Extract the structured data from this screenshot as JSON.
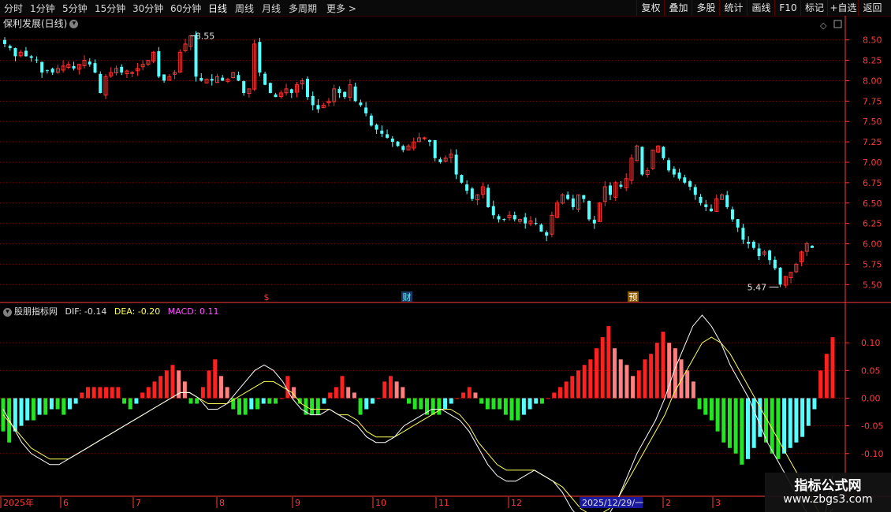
{
  "toolbar": {
    "timeframes": [
      "分时",
      "1分钟",
      "5分钟",
      "15分钟",
      "30分钟",
      "60分钟",
      "日线",
      "周线",
      "月线",
      "多周期",
      "更多 >"
    ],
    "active": "日线",
    "buttons": [
      "复权",
      "叠加",
      "多股",
      "统计",
      "画线",
      "F10",
      "标记",
      "+自选",
      "返回"
    ]
  },
  "price_panel": {
    "title": "保利发展(日线)",
    "high_label": "8.55",
    "low_label": "5.47",
    "markers": [
      "$",
      "财",
      "预"
    ]
  },
  "indicator_panel": {
    "title": "股朋指标网",
    "dif_label": "DIF: -0.14",
    "dea_label": "DEA: -0.20",
    "macd_label": "MACD: 0.11"
  },
  "date_axis": {
    "labels": [
      "2025年",
      "6",
      "7",
      "8",
      "9",
      "10",
      "11",
      "12",
      "2025/12/29/一",
      "2",
      "3"
    ]
  },
  "watermark": {
    "line1": "指标公式网",
    "line2": "www.zbgs3.com"
  },
  "colors": {
    "up": "#ff3232",
    "down": "#54ffff",
    "macd_pos": "#ff2020",
    "macd_pos_fade": "#ff8080",
    "macd_neg": "#22e622",
    "macd_neg_fade": "#54ffff",
    "dif": "#ffffff",
    "dea": "#ffff55",
    "grid": "#8b0000",
    "axis": "#ff3c3c"
  },
  "chart_data": [
    {
      "type": "candlestick",
      "title": "保利发展(日线)",
      "ylim": [
        5.3,
        8.7
      ],
      "y_ticks": [
        5.5,
        5.75,
        6.0,
        6.25,
        6.5,
        6.75,
        7.0,
        7.25,
        7.5,
        7.75,
        8.0,
        8.25,
        8.5
      ],
      "close_path": [
        8.45,
        8.4,
        8.3,
        8.35,
        8.3,
        8.28,
        8.25,
        8.1,
        8.12,
        8.1,
        8.15,
        8.18,
        8.2,
        8.15,
        8.2,
        8.25,
        8.2,
        8.1,
        7.85,
        8.05,
        8.1,
        8.15,
        8.1,
        8.12,
        8.1,
        8.15,
        8.2,
        8.25,
        8.35,
        8.05,
        8.0,
        8.05,
        8.1,
        8.35,
        8.45,
        8.55,
        8.05,
        8.0,
        8.02,
        8.0,
        8.05,
        8.0,
        8.02,
        8.1,
        8.0,
        7.85,
        7.9,
        8.45,
        8.1,
        7.95,
        7.85,
        7.8,
        7.85,
        7.9,
        7.85,
        7.95,
        8.0,
        7.8,
        7.7,
        7.65,
        7.7,
        7.75,
        7.9,
        7.85,
        7.8,
        7.95,
        7.75,
        7.7,
        7.6,
        7.45,
        7.4,
        7.35,
        7.3,
        7.25,
        7.2,
        7.15,
        7.2,
        7.25,
        7.3,
        7.3,
        7.25,
        7.05,
        7.0,
        7.05,
        7.1,
        6.85,
        6.75,
        6.65,
        6.55,
        6.6,
        6.7,
        6.45,
        6.35,
        6.3,
        6.3,
        6.35,
        6.3,
        6.3,
        6.25,
        6.28,
        6.25,
        6.15,
        6.1,
        6.35,
        6.5,
        6.6,
        6.55,
        6.45,
        6.6,
        6.55,
        6.3,
        6.25,
        6.5,
        6.7,
        6.6,
        6.75,
        6.7,
        6.8,
        7.05,
        7.2,
        6.85,
        6.9,
        7.15,
        7.2,
        7.05,
        6.9,
        6.85,
        6.8,
        6.75,
        6.7,
        6.6,
        6.5,
        6.45,
        6.4,
        6.55,
        6.6,
        6.45,
        6.3,
        6.2,
        6.05,
        6.0,
        5.95,
        5.85,
        5.9,
        5.8,
        5.7,
        5.5,
        5.6,
        5.65,
        5.75,
        5.9,
        6.0,
        5.95
      ],
      "high": 8.55,
      "low": 5.47
    },
    {
      "type": "macd",
      "title": "股朋指标网",
      "ylim": [
        -0.17,
        0.15
      ],
      "y_ticks": [
        0.1,
        0.05,
        0.0,
        -0.05,
        -0.1
      ],
      "macd_hist": [
        -0.06,
        -0.08,
        -0.06,
        -0.05,
        -0.04,
        -0.04,
        -0.03,
        -0.03,
        -0.02,
        -0.02,
        -0.03,
        -0.02,
        -0.01,
        0.01,
        0.02,
        0.02,
        0.02,
        0.02,
        0.02,
        0.02,
        -0.01,
        -0.02,
        -0.01,
        0.01,
        0.02,
        0.03,
        0.04,
        0.05,
        0.06,
        0.05,
        0.03,
        -0.01,
        -0.01,
        0.02,
        0.05,
        0.07,
        0.04,
        0.02,
        -0.02,
        -0.03,
        -0.03,
        -0.02,
        -0.02,
        -0.01,
        -0.01,
        -0.01,
        0.0,
        0.04,
        0.02,
        -0.01,
        -0.03,
        -0.03,
        -0.03,
        -0.01,
        0.01,
        0.02,
        0.04,
        0.02,
        0.01,
        -0.03,
        -0.02,
        -0.01,
        0.0,
        0.03,
        0.04,
        0.03,
        0.02,
        -0.01,
        -0.02,
        -0.02,
        -0.03,
        -0.03,
        -0.03,
        -0.02,
        -0.01,
        0.0,
        0.01,
        0.02,
        0.01,
        -0.01,
        -0.02,
        -0.02,
        -0.02,
        -0.03,
        -0.04,
        -0.04,
        -0.03,
        -0.02,
        -0.01,
        -0.01,
        0.0,
        0.01,
        0.02,
        0.03,
        0.04,
        0.05,
        0.06,
        0.07,
        0.09,
        0.11,
        0.13,
        0.09,
        0.07,
        0.06,
        0.04,
        0.05,
        0.07,
        0.08,
        0.1,
        0.12,
        0.1,
        0.09,
        0.07,
        0.05,
        0.03,
        -0.02,
        -0.03,
        -0.04,
        -0.06,
        -0.08,
        -0.09,
        -0.1,
        -0.12,
        -0.11,
        -0.09,
        -0.07,
        -0.08,
        -0.1,
        -0.11,
        -0.1,
        -0.09,
        -0.08,
        -0.07,
        -0.05,
        -0.02,
        0.05,
        0.08,
        0.11
      ],
      "dif": [
        -0.02,
        -0.05,
        -0.08,
        -0.1,
        -0.11,
        -0.12,
        -0.12,
        -0.11,
        -0.1,
        -0.09,
        -0.08,
        -0.07,
        -0.06,
        -0.05,
        -0.04,
        -0.03,
        -0.02,
        -0.01,
        0.0,
        0.01,
        0.01,
        0.0,
        -0.02,
        -0.02,
        -0.01,
        0.01,
        0.03,
        0.05,
        0.06,
        0.05,
        0.03,
        0.0,
        -0.02,
        -0.03,
        -0.03,
        -0.02,
        -0.03,
        -0.04,
        -0.05,
        -0.07,
        -0.08,
        -0.08,
        -0.07,
        -0.05,
        -0.04,
        -0.03,
        -0.02,
        -0.02,
        -0.03,
        -0.04,
        -0.06,
        -0.09,
        -0.12,
        -0.14,
        -0.15,
        -0.15,
        -0.14,
        -0.13,
        -0.14,
        -0.15,
        -0.17,
        -0.2,
        -0.22,
        -0.23,
        -0.22,
        -0.21,
        -0.18,
        -0.14,
        -0.1,
        -0.07,
        -0.04,
        0.0,
        0.05,
        0.09,
        0.13,
        0.15,
        0.13,
        0.1,
        0.06,
        0.03,
        0.0,
        -0.04,
        -0.08,
        -0.11,
        -0.14,
        -0.17,
        -0.2,
        -0.23,
        -0.25,
        -0.14
      ],
      "dea": [
        -0.03,
        -0.05,
        -0.07,
        -0.09,
        -0.1,
        -0.11,
        -0.11,
        -0.11,
        -0.1,
        -0.09,
        -0.08,
        -0.07,
        -0.06,
        -0.05,
        -0.04,
        -0.03,
        -0.02,
        -0.01,
        0.0,
        0.01,
        0.01,
        0.0,
        -0.01,
        -0.01,
        -0.01,
        0.0,
        0.01,
        0.02,
        0.03,
        0.03,
        0.02,
        0.01,
        -0.01,
        -0.02,
        -0.02,
        -0.02,
        -0.03,
        -0.03,
        -0.04,
        -0.06,
        -0.07,
        -0.07,
        -0.07,
        -0.06,
        -0.05,
        -0.04,
        -0.03,
        -0.02,
        -0.02,
        -0.03,
        -0.05,
        -0.08,
        -0.1,
        -0.12,
        -0.13,
        -0.13,
        -0.13,
        -0.13,
        -0.14,
        -0.15,
        -0.16,
        -0.18,
        -0.2,
        -0.21,
        -0.21,
        -0.2,
        -0.18,
        -0.15,
        -0.12,
        -0.09,
        -0.06,
        -0.03,
        0.01,
        0.04,
        0.07,
        0.1,
        0.11,
        0.1,
        0.08,
        0.05,
        0.02,
        -0.01,
        -0.04,
        -0.07,
        -0.1,
        -0.13,
        -0.16,
        -0.19,
        -0.22,
        -0.2
      ],
      "labels": {
        "DIF": -0.14,
        "DEA": -0.2,
        "MACD": 0.11
      }
    }
  ]
}
